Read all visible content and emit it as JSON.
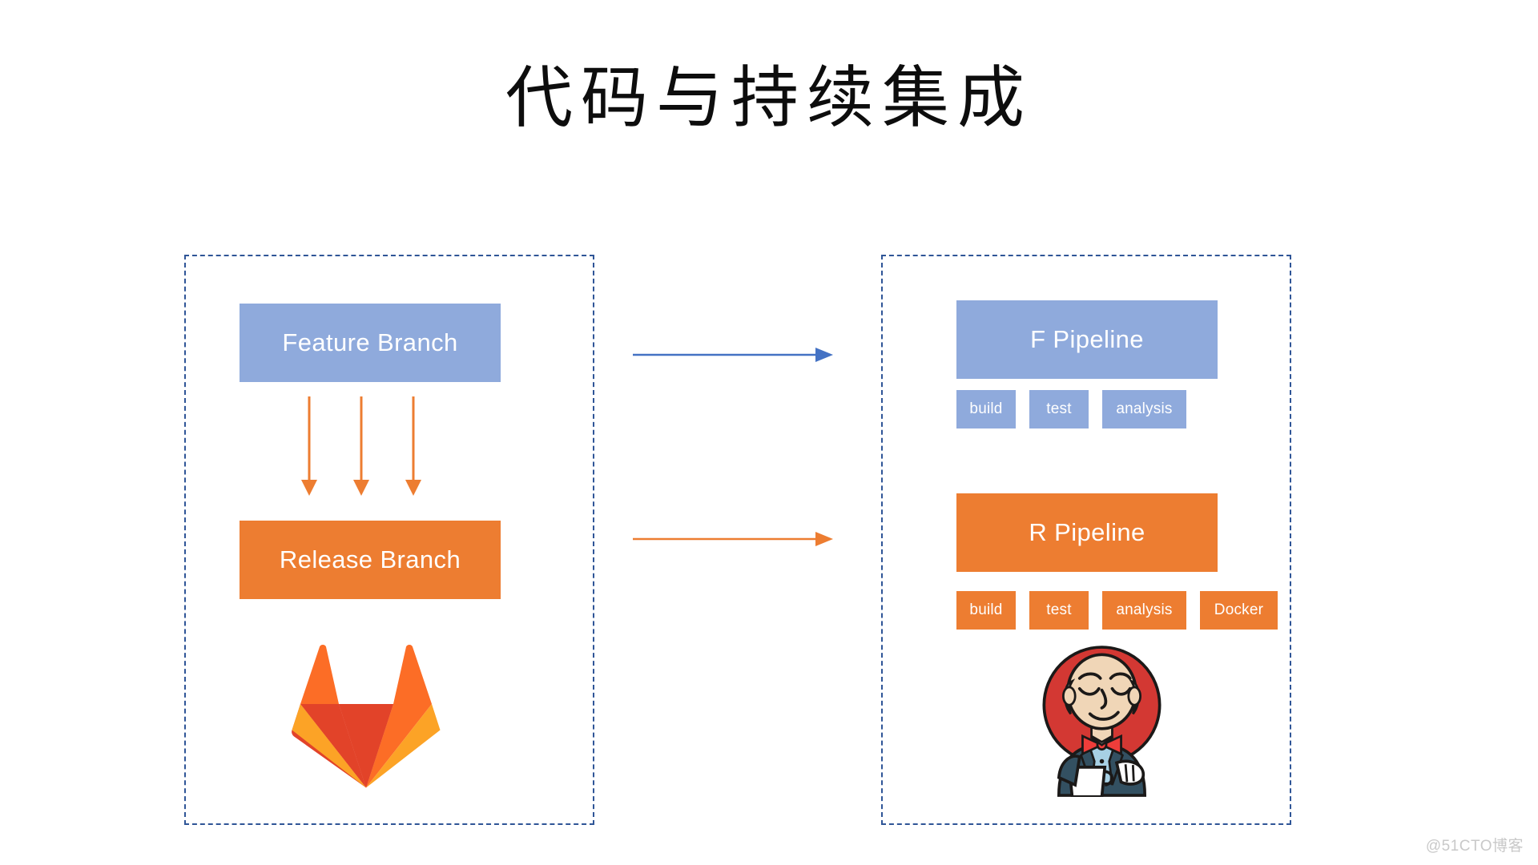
{
  "slide": {
    "title": "代码与持续集成",
    "background_color": "#FFFFFF",
    "watermark": "@51CTO博客"
  },
  "colors": {
    "blue_fill": "#8FAADC",
    "orange_fill": "#ED7D31",
    "panel_border": "#2F5597",
    "blue_arrow": "#4472C4",
    "orange_arrow": "#ED7D31",
    "text_on_fill": "#FFFFFF",
    "title_text": "#0D0D0D",
    "watermark_text": "#C9C9C9"
  },
  "left_panel": {
    "name": "source-code-panel",
    "feature_branch": {
      "label": "Feature Branch",
      "fill": "#8FAADC"
    },
    "release_branch": {
      "label": "Release Branch",
      "fill": "#ED7D31"
    },
    "merge_arrows": {
      "count": 3,
      "color": "#ED7D31",
      "direction": "down"
    },
    "logo": {
      "name": "gitlab-logo",
      "alt": "GitLab"
    }
  },
  "right_panel": {
    "name": "ci-pipeline-panel",
    "pipelines": [
      {
        "label": "F Pipeline",
        "fill": "#8FAADC",
        "stages": [
          "build",
          "test",
          "analysis"
        ]
      },
      {
        "label": "R Pipeline",
        "fill": "#ED7D31",
        "stages": [
          "build",
          "test",
          "analysis",
          "Docker"
        ]
      }
    ],
    "logo": {
      "name": "jenkins-logo",
      "alt": "Jenkins"
    }
  },
  "connectors": [
    {
      "name": "feature-to-f-pipeline",
      "color": "#4472C4",
      "direction": "right"
    },
    {
      "name": "release-to-r-pipeline",
      "color": "#ED7D31",
      "direction": "right"
    }
  ]
}
